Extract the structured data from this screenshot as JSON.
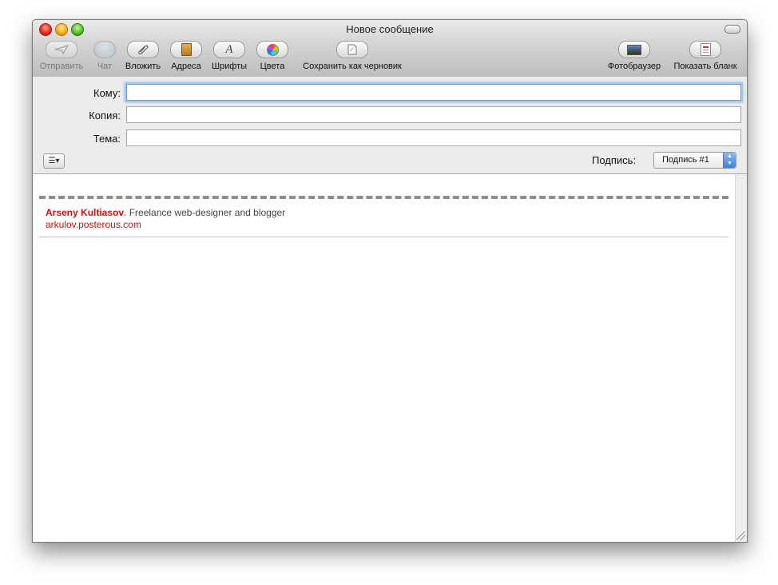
{
  "window": {
    "title": "Новое сообщение"
  },
  "toolbar": {
    "send": {
      "label": "Отправить",
      "icon": "paper-plane-icon",
      "enabled": false
    },
    "chat": {
      "label": "Чат",
      "icon": "chat-bubble-icon",
      "enabled": false
    },
    "attach": {
      "label": "Вложить",
      "icon": "paperclip-icon"
    },
    "addresses": {
      "label": "Адреса",
      "icon": "address-book-icon"
    },
    "fonts": {
      "label": "Шрифты",
      "icon": "font-icon",
      "glyph": "A"
    },
    "colors": {
      "label": "Цвета",
      "icon": "color-wheel-icon"
    },
    "save_draft": {
      "label": "Сохранить как черновик",
      "icon": "draft-icon"
    },
    "photo_browser": {
      "label": "Фотобраузер",
      "icon": "photo-icon"
    },
    "show_stationery": {
      "label": "Показать бланк",
      "icon": "stationery-icon"
    }
  },
  "header": {
    "to": {
      "label": "Кому:",
      "value": ""
    },
    "cc": {
      "label": "Копия:",
      "value": ""
    },
    "subject": {
      "label": "Тема:",
      "value": ""
    },
    "signature": {
      "label": "Подпись:",
      "selected": "Подпись #1"
    }
  },
  "body": {
    "signature_name": "Arseny Kultiasov",
    "signature_tagline": ". Freelance web-designer and blogger",
    "signature_link": "arkulov.posterous.com"
  },
  "colors": {
    "accent": "#d01010",
    "focus": "#6d9ad6"
  }
}
